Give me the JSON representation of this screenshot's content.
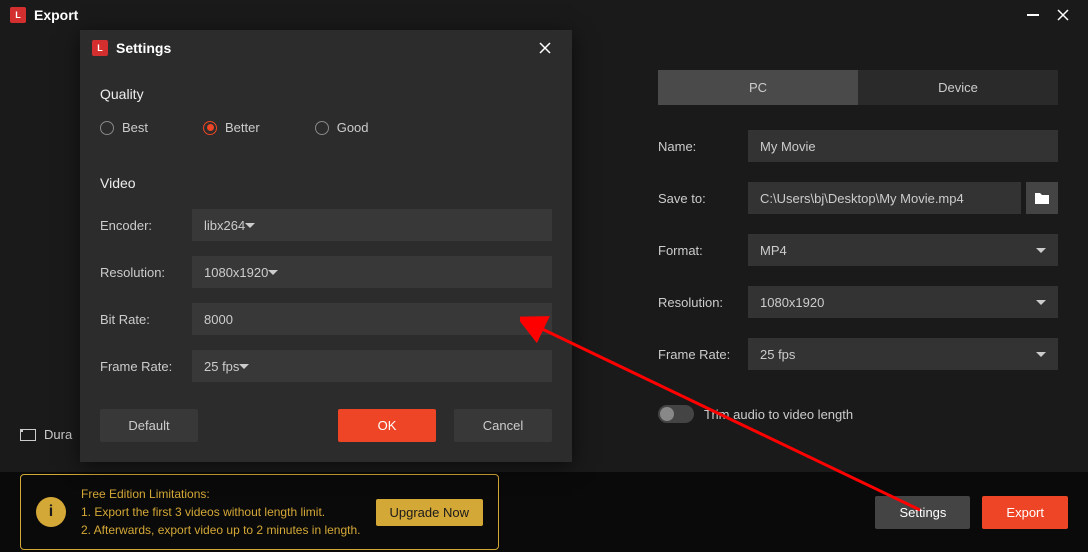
{
  "window": {
    "title": "Export"
  },
  "export": {
    "tabs": {
      "pc": "PC",
      "device": "Device"
    },
    "labels": {
      "name": "Name:",
      "save_to": "Save to:",
      "format": "Format:",
      "resolution": "Resolution:",
      "frame_rate": "Frame Rate:",
      "trim_audio": "Trim audio to video length",
      "duration_prefix": "Dura"
    },
    "values": {
      "name": "My Movie",
      "save_to": "C:\\Users\\bj\\Desktop\\My Movie.mp4",
      "format": "MP4",
      "resolution": "1080x1920",
      "frame_rate": "25 fps"
    },
    "buttons": {
      "settings": "Settings",
      "export": "Export"
    }
  },
  "limitations": {
    "heading": "Free Edition Limitations:",
    "line1": "1. Export the first 3 videos without length limit.",
    "line2": "2. Afterwards, export video up to 2 minutes in length.",
    "upgrade": "Upgrade Now"
  },
  "settings_dialog": {
    "title": "Settings",
    "sections": {
      "quality": "Quality",
      "video": "Video"
    },
    "quality_options": {
      "best": "Best",
      "better": "Better",
      "good": "Good"
    },
    "labels": {
      "encoder": "Encoder:",
      "resolution": "Resolution:",
      "bit_rate": "Bit Rate:",
      "frame_rate": "Frame Rate:"
    },
    "values": {
      "encoder": "libx264",
      "resolution": "1080x1920",
      "bit_rate": "8000",
      "frame_rate": "25 fps"
    },
    "buttons": {
      "default": "Default",
      "ok": "OK",
      "cancel": "Cancel"
    }
  }
}
